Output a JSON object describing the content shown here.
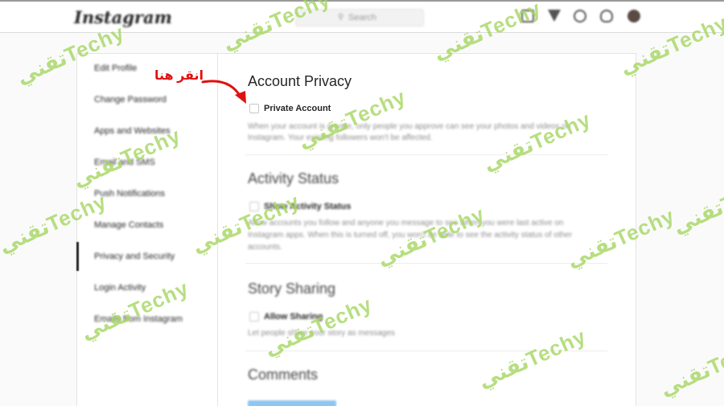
{
  "topbar": {
    "logo": "Instagram",
    "search_placeholder": "Search",
    "icons": [
      "home-icon",
      "direct-icon",
      "explore-icon",
      "activity-icon",
      "avatar"
    ]
  },
  "sidebar": {
    "items": [
      {
        "label": "Edit Profile"
      },
      {
        "label": "Change Password"
      },
      {
        "label": "Apps and Websites"
      },
      {
        "label": "Email and SMS"
      },
      {
        "label": "Push Notifications"
      },
      {
        "label": "Manage Contacts"
      },
      {
        "label": "Privacy and Security",
        "active": true
      },
      {
        "label": "Login Activity"
      },
      {
        "label": "Emails from Instagram"
      }
    ]
  },
  "main": {
    "account_privacy": {
      "title": "Account Privacy",
      "checkbox_label": "Private Account",
      "description_line1": "When your account is private, only people you approve can see your photos and videos on",
      "description_line2": "Instagram. Your existing followers won't be affected."
    },
    "activity_status": {
      "title": "Activity Status",
      "checkbox_label": "Show Activity Status",
      "description_line1": "Allow accounts you follow and anyone you message to see when you were last active on",
      "description_line2": "Instagram apps. When this is turned off, you won't be able to see the activity status of other",
      "description_line3": "accounts."
    },
    "story_sharing": {
      "title": "Story Sharing",
      "checkbox_label": "Allow Sharing",
      "description_line1": "Let people share your story as messages"
    },
    "comments": {
      "title": "Comments"
    }
  },
  "annotation": {
    "text": "انقر هنا",
    "color": "#e01010"
  },
  "watermark": {
    "text": "تقنيTechy",
    "color": "#a4d65e"
  }
}
